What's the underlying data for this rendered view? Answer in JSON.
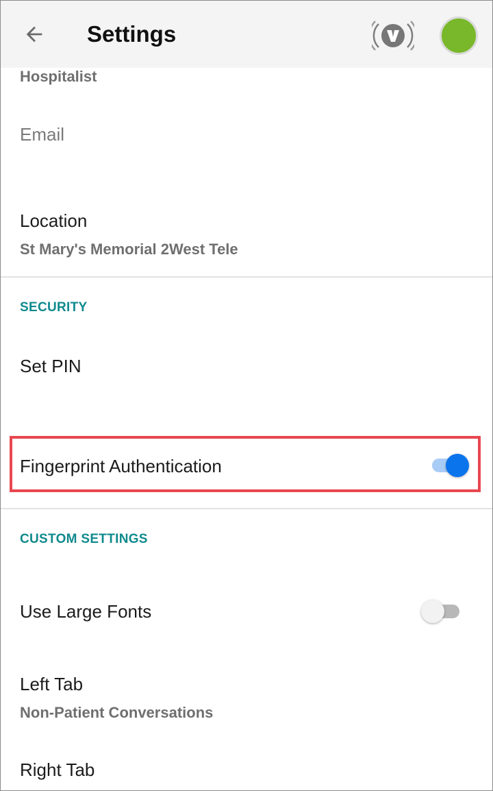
{
  "header": {
    "title": "Settings",
    "back_icon": "arrow-left-icon",
    "vocera_icon": "vocera-badge-icon",
    "status_color": "#78b82a"
  },
  "profile": {
    "role": "Hospitalist",
    "email_label": "Email",
    "location_label": "Location",
    "location_value": "St Mary's Memorial 2West Tele"
  },
  "security": {
    "header": "SECURITY",
    "set_pin_label": "Set PIN",
    "fingerprint_label": "Fingerprint Authentication",
    "fingerprint_enabled": true
  },
  "custom": {
    "header": "CUSTOM SETTINGS",
    "large_fonts_label": "Use Large Fonts",
    "large_fonts_enabled": false,
    "left_tab_label": "Left Tab",
    "left_tab_value": "Non-Patient Conversations",
    "right_tab_label": "Right Tab"
  },
  "colors": {
    "accent": "#0f8a8d",
    "toggle_on": "#0a74ec",
    "highlight": "#e8474f"
  }
}
